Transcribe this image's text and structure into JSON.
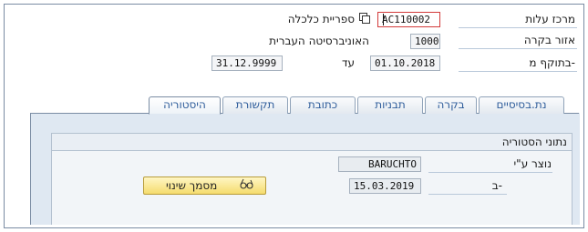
{
  "header": {
    "cost_center_label": "מרכז עלות",
    "cost_center_value": "AC110002",
    "library_label": "ספריית כלכלה",
    "controlling_area_label": "אזור בקרה",
    "controlling_area_value": "1000",
    "controlling_area_text": "האוניברסיטה העברית",
    "valid_from_label": "בתוקף מ-",
    "valid_from_value": "01.10.2018",
    "valid_to_label": "עד",
    "valid_to_value": "31.12.9999"
  },
  "tabs": [
    {
      "label": "נת.בסיסיים"
    },
    {
      "label": "בקרה"
    },
    {
      "label": "תבניות"
    },
    {
      "label": "כתובת"
    },
    {
      "label": "תקשורת"
    },
    {
      "label": "היסטוריה",
      "active": true
    }
  ],
  "history": {
    "group_title": "נתוני הסטוריה",
    "created_by_label": "נוצר ע\"י",
    "created_by_value": "BARUCHTO",
    "on_label": "ב-",
    "on_value": "15.03.2019",
    "change_doc_button": "מסמך שינוי"
  },
  "colors": {
    "tab_text": "#2f5d9b",
    "tab_area_bg": "#dfe8f2",
    "key_field_border": "#d23a3a",
    "button_yellow": "#f5dc6e"
  }
}
